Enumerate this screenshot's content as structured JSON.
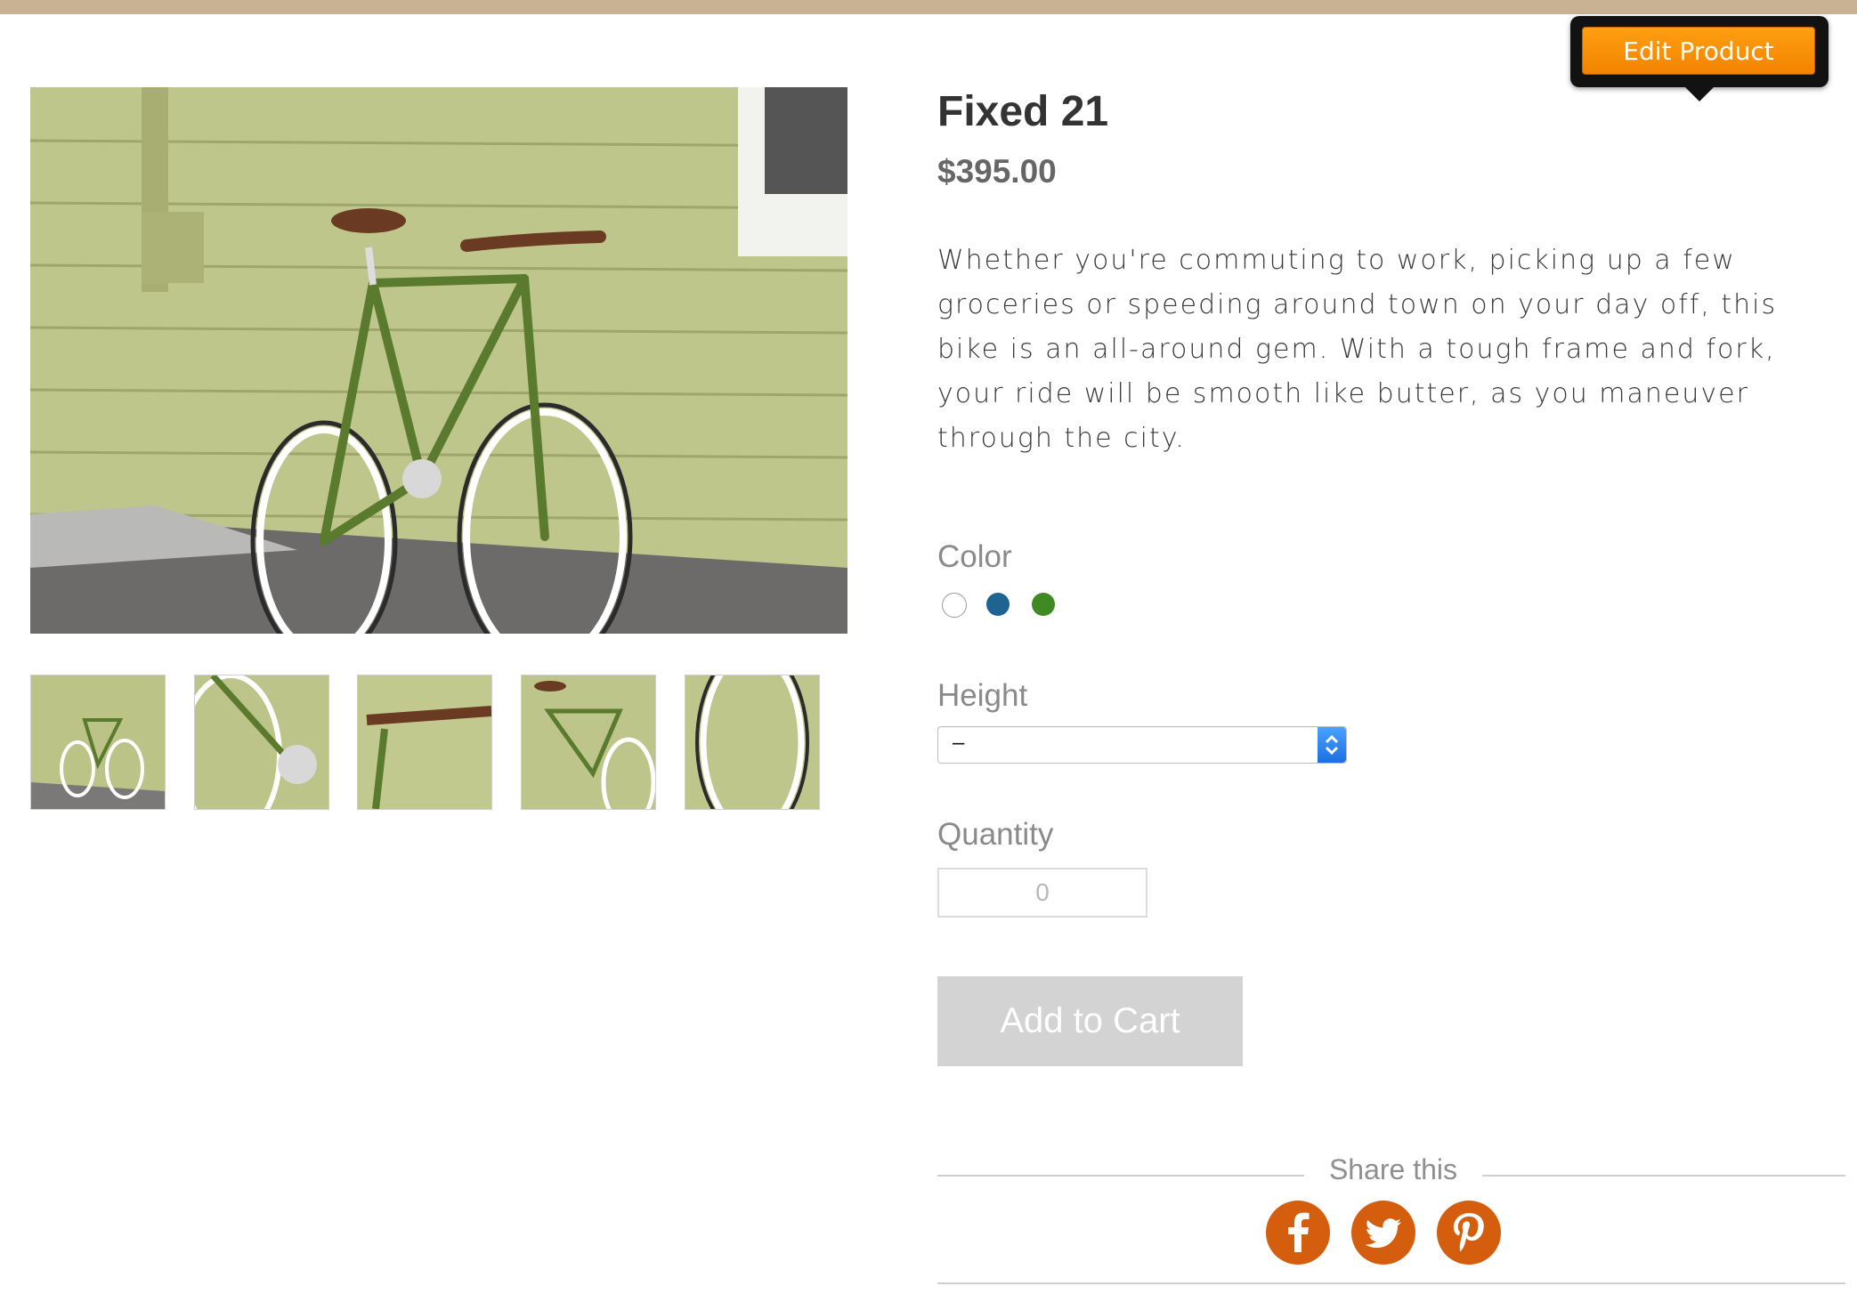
{
  "product": {
    "title": "Fixed 21",
    "price": "$395.00",
    "description": "Whether you're commuting to work, picking up a few groceries or speeding around town on your day off, this bike is an all-around gem. With a tough frame and fork, your ride will be smooth like butter, as you maneuver through the city."
  },
  "options": {
    "color_label": "Color",
    "colors": [
      {
        "name": "white",
        "hex": "#ffffff"
      },
      {
        "name": "blue",
        "hex": "#1f6491"
      },
      {
        "name": "green",
        "hex": "#3f8a22"
      }
    ],
    "height_label": "Height",
    "height_value": "–",
    "quantity_label": "Quantity",
    "quantity_placeholder": "0"
  },
  "cart": {
    "add_label": "Add to Cart"
  },
  "share": {
    "label": "Share this",
    "networks": [
      "facebook-icon",
      "twitter-icon",
      "pinterest-icon"
    ]
  },
  "admin": {
    "edit_label": "Edit Product"
  },
  "colors": {
    "top_strip": "#c8b293",
    "social": "#d55e0e",
    "edit_button": "#f28300",
    "cart_button": "#d3d3d3"
  }
}
